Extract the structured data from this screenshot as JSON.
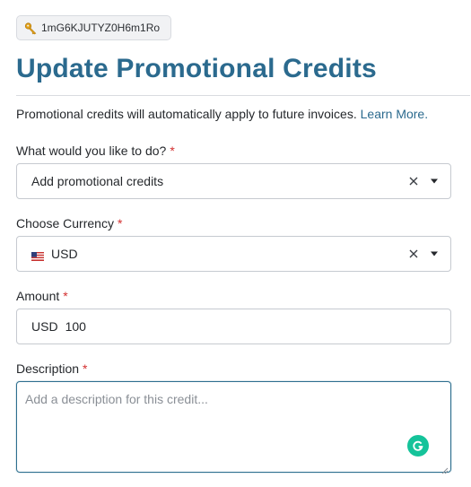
{
  "record": {
    "id": "1mG6KJUTYZ0H6m1Ro"
  },
  "page": {
    "title": "Update Promotional Credits",
    "intro_text": "Promotional credits will automatically apply to future invoices.",
    "learn_more": "Learn More."
  },
  "form": {
    "action": {
      "label": "What would you like to do?",
      "value": "Add promotional credits"
    },
    "currency": {
      "label": "Choose Currency",
      "value": "USD",
      "flag_icon": "us-flag-icon"
    },
    "amount": {
      "label": "Amount",
      "currency": "USD",
      "value": "100"
    },
    "description": {
      "label": "Description",
      "placeholder": "Add a description for this credit...",
      "value": ""
    },
    "required_marker": "*"
  },
  "colors": {
    "title": "#2b6a8e",
    "link": "#2b6a8e",
    "required": "#d32f2f",
    "focus_border": "#2e6f8f",
    "grammarly": "#15c39a"
  }
}
